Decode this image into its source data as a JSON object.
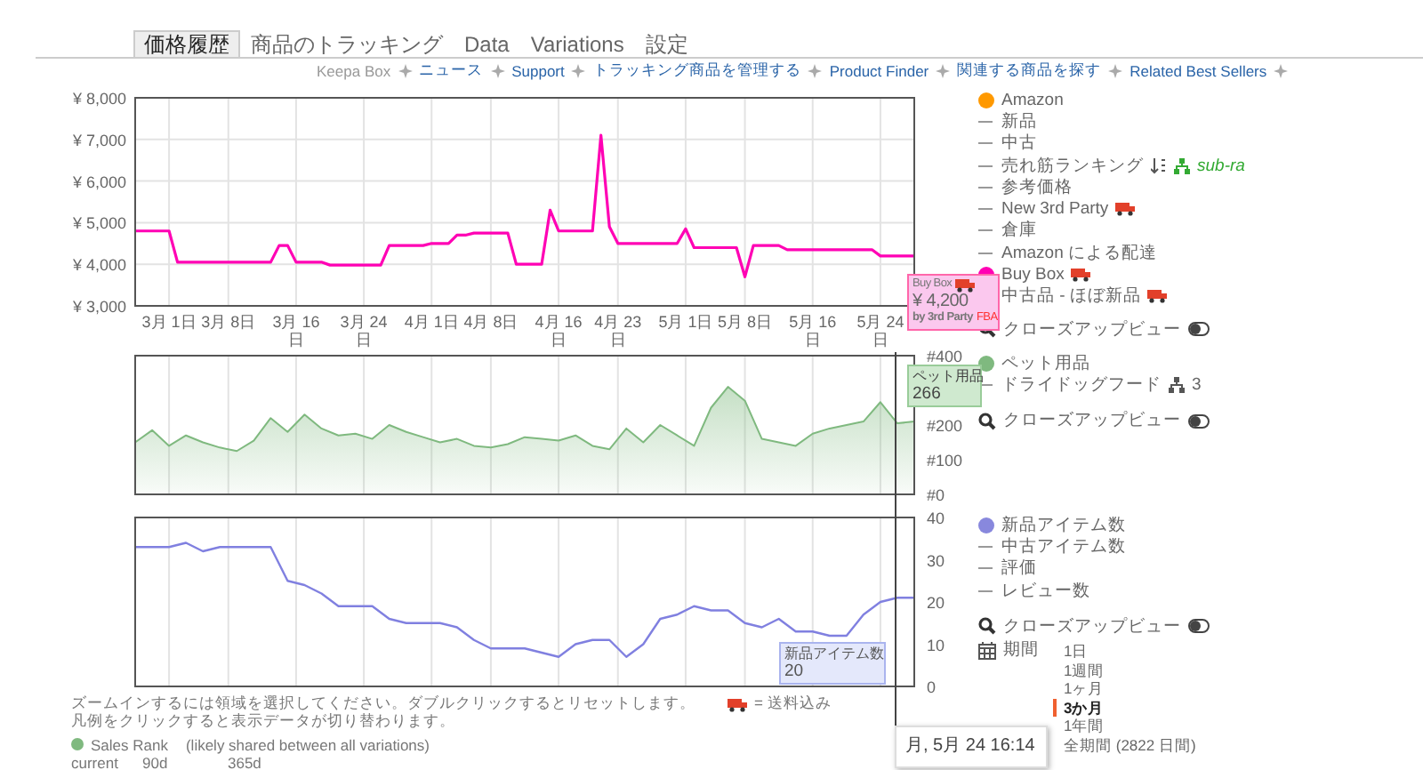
{
  "tabs": [
    {
      "label": "価格履歴",
      "selected": true
    },
    {
      "label": "商品のトラッキング",
      "selected": false
    },
    {
      "label": "Data",
      "selected": false
    },
    {
      "label": "Variations",
      "selected": false
    },
    {
      "label": "設定",
      "selected": false
    }
  ],
  "links": [
    {
      "label": "Keepa Box",
      "kind": "plain"
    },
    {
      "label": "ニュース",
      "kind": "link"
    },
    {
      "label": "Support",
      "kind": "link"
    },
    {
      "label": "トラッキング商品を管理する",
      "kind": "link"
    },
    {
      "label": "Product Finder",
      "kind": "link"
    },
    {
      "label": "関連する商品を探す",
      "kind": "link"
    },
    {
      "label": "Related Best Sellers",
      "kind": "link"
    }
  ],
  "price_chart": {
    "chart_data": {
      "type": "line",
      "grid": true,
      "ylim": [
        3000,
        8000
      ],
      "yticks": [
        {
          "value": 3000,
          "label": "¥ 3,000"
        },
        {
          "value": 4000,
          "label": "¥ 4,000"
        },
        {
          "value": 5000,
          "label": "¥ 5,000"
        },
        {
          "value": 6000,
          "label": "¥ 6,000"
        },
        {
          "value": 7000,
          "label": "¥ 7,000"
        },
        {
          "value": 8000,
          "label": "¥ 8,000"
        }
      ],
      "categories": [
        null,
        null,
        null,
        null,
        "3月 1日",
        null,
        null,
        null,
        null,
        null,
        null,
        "3月 8日",
        null,
        null,
        null,
        null,
        null,
        null,
        null,
        "3月 16日",
        null,
        null,
        null,
        null,
        null,
        null,
        null,
        "3月 24日",
        null,
        null,
        null,
        null,
        null,
        null,
        null,
        "4月 1日",
        null,
        null,
        null,
        null,
        null,
        null,
        "4月 8日",
        null,
        null,
        null,
        null,
        null,
        null,
        null,
        "4月 16日",
        null,
        null,
        null,
        null,
        null,
        null,
        "4月 23日",
        null,
        null,
        null,
        null,
        null,
        null,
        null,
        "5月 1日",
        null,
        null,
        null,
        null,
        null,
        null,
        "5月 8日",
        null,
        null,
        null,
        null,
        null,
        null,
        null,
        "5月 16日",
        null,
        null,
        null,
        null,
        null,
        null,
        null,
        "5月 24日",
        null,
        null,
        null,
        null
      ],
      "series": [
        {
          "color": "#ff00b4",
          "values": [
            4800,
            4800,
            4800,
            4800,
            4800,
            4050,
            4050,
            4050,
            4050,
            4050,
            4050,
            4050,
            4050,
            4050,
            4050,
            4050,
            4050,
            4450,
            4450,
            4050,
            4050,
            4050,
            4050,
            3980,
            3980,
            3980,
            3980,
            3980,
            3980,
            3980,
            4450,
            4450,
            4450,
            4450,
            4450,
            4500,
            4500,
            4500,
            4700,
            4700,
            4750,
            4750,
            4750,
            4750,
            4750,
            4000,
            4000,
            4000,
            4000,
            5300,
            4800,
            4800,
            4800,
            4800,
            4800,
            7100,
            4900,
            4500,
            4500,
            4500,
            4500,
            4500,
            4500,
            4500,
            4500,
            4850,
            4400,
            4400,
            4400,
            4400,
            4400,
            4400,
            3700,
            4450,
            4450,
            4450,
            4450,
            4350,
            4350,
            4350,
            4350,
            4350,
            4350,
            4350,
            4350,
            4350,
            4350,
            4350,
            4200,
            4200,
            4200,
            4200,
            4200
          ]
        }
      ]
    },
    "legend": {
      "items": [
        {
          "label": "Amazon",
          "shown": true,
          "color": "#ff9900",
          "kind": "series"
        },
        {
          "label": "新品",
          "shown": false,
          "kind": "series"
        },
        {
          "label": "中古",
          "shown": false,
          "kind": "series"
        },
        {
          "label": "売れ筋ランキング",
          "shown": false,
          "kind": "rank",
          "sub_label": "sub-ra"
        },
        {
          "label": "参考価格",
          "shown": false,
          "kind": "series"
        },
        {
          "label": "New 3rd Party",
          "shown": false,
          "truck": true,
          "kind": "series"
        },
        {
          "label": "倉庫",
          "shown": false,
          "kind": "series"
        },
        {
          "label": "Amazon による配達",
          "shown": false,
          "kind": "series"
        },
        {
          "label": "Buy Box",
          "shown": true,
          "color": "#ff00b4",
          "truck": true,
          "kind": "series"
        },
        {
          "label": "中古品 - ほぼ新品",
          "shown": false,
          "truck": true,
          "kind": "series"
        }
      ],
      "closeup": {
        "label": "クローズアップビュー",
        "on": false
      }
    }
  },
  "rank_chart": {
    "chart_data": {
      "type": "area",
      "grid": true,
      "ylim": [
        0,
        400
      ],
      "yticks": [
        {
          "value": 0,
          "label": "#0"
        },
        {
          "value": 100,
          "label": "#100"
        },
        {
          "value": 200,
          "label": "#200"
        },
        {
          "value": 400,
          "label": "#400"
        }
      ],
      "categories": [
        null,
        null,
        null,
        null,
        null,
        null,
        null,
        null,
        null,
        null,
        null,
        null,
        null,
        null,
        null,
        null,
        null,
        null,
        null,
        null,
        null,
        null,
        null,
        null,
        null,
        null,
        null,
        null,
        null,
        null,
        null,
        null,
        null,
        null,
        null,
        null,
        null,
        null,
        null,
        null,
        null,
        null,
        null,
        null,
        null,
        null,
        null
      ],
      "series": [
        {
          "color": "#7fb97f",
          "values": [
            150,
            185,
            140,
            170,
            150,
            135,
            125,
            155,
            220,
            180,
            230,
            190,
            170,
            175,
            160,
            200,
            180,
            165,
            150,
            160,
            140,
            135,
            145,
            165,
            160,
            155,
            170,
            140,
            130,
            190,
            150,
            200,
            170,
            140,
            250,
            310,
            270,
            160,
            150,
            140,
            175,
            190,
            200,
            210,
            266,
            205,
            210
          ]
        }
      ]
    },
    "legend": {
      "items": [
        {
          "label": "ペット用品",
          "shown": true,
          "color": "#7fb97f",
          "kind": "series"
        },
        {
          "label": "ドライドッグフード",
          "kind": "category",
          "count": "3"
        }
      ],
      "closeup": {
        "label": "クローズアップビュー",
        "on": false
      }
    }
  },
  "count_chart": {
    "chart_data": {
      "type": "line",
      "grid": true,
      "ylim": [
        0,
        40
      ],
      "yticks": [
        {
          "value": 0,
          "label": "0"
        },
        {
          "value": 10,
          "label": "10"
        },
        {
          "value": 20,
          "label": "20"
        },
        {
          "value": 30,
          "label": "30"
        },
        {
          "value": 40,
          "label": "40"
        }
      ],
      "categories": [
        null,
        null,
        null,
        null,
        null,
        null,
        null,
        null,
        null,
        null,
        null,
        null,
        null,
        null,
        null,
        null,
        null,
        null,
        null,
        null,
        null,
        null,
        null,
        null,
        null,
        null,
        null,
        null,
        null,
        null,
        null,
        null,
        null,
        null,
        null,
        null,
        null,
        null,
        null,
        null,
        null,
        null,
        null,
        null,
        null,
        null,
        null
      ],
      "series": [
        {
          "color": "#8080e0",
          "values": [
            33,
            33,
            33,
            34,
            32,
            33,
            33,
            33,
            33,
            25,
            24,
            22,
            19,
            19,
            19,
            16,
            15,
            15,
            15,
            14,
            11,
            9,
            9,
            9,
            8,
            7,
            10,
            11,
            11,
            7,
            10,
            16,
            17,
            19,
            18,
            18,
            15,
            14,
            16,
            13,
            13,
            12,
            12,
            17,
            20,
            21,
            21
          ]
        }
      ]
    },
    "legend": {
      "items": [
        {
          "label": "新品アイテム数",
          "shown": true,
          "color": "#8888dd",
          "kind": "series"
        },
        {
          "label": "中古アイテム数",
          "shown": false,
          "kind": "series"
        },
        {
          "label": "評価",
          "shown": false,
          "kind": "series"
        },
        {
          "label": "レビュー数",
          "shown": false,
          "kind": "series"
        }
      ],
      "closeup": {
        "label": "クローズアップビュー",
        "on": false
      },
      "period": {
        "label": "期間",
        "options": [
          {
            "label": "1日",
            "selected": false
          },
          {
            "label": "1週間",
            "selected": false
          },
          {
            "label": "1ヶ月",
            "selected": false
          },
          {
            "label": "3か月",
            "selected": true
          },
          {
            "label": "1年間",
            "selected": false
          },
          {
            "label": "全期間 (2822 日間)",
            "selected": false
          }
        ]
      }
    }
  },
  "tooltips": {
    "price": {
      "title": "Buy Box",
      "price": "¥ 4,200",
      "seller": "by 3rd Party",
      "fulfillment": "FBA"
    },
    "rank": {
      "title": "ペット用品",
      "value": "266"
    },
    "count": {
      "title": "新品アイテム数",
      "value": "20"
    },
    "date": "月, 5月 24 16:14"
  },
  "footer": {
    "hint": "ズームインするには領域を選択してください。ダブルクリックするとリセットします。",
    "shipping_note": "= 送料込み",
    "legend_hint": "凡例をクリックすると表示データが切り替わります。",
    "sales_rank": {
      "label": "Sales Rank",
      "note": "(likely shared between all variations)",
      "color": "#7fb97f"
    },
    "columns": [
      "current",
      "90d",
      "365d"
    ]
  }
}
